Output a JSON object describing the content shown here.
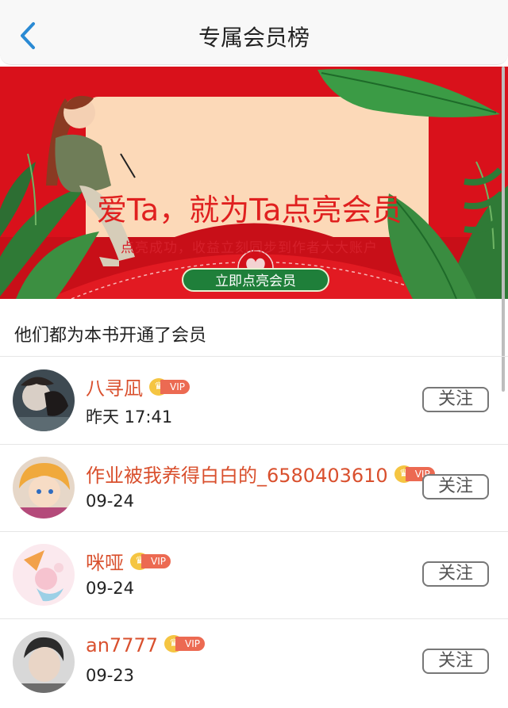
{
  "header": {
    "title": "专属会员榜",
    "back_icon": "chevron-left-icon",
    "accent": "#2a8ad4"
  },
  "banner": {
    "headline": "爱Ta，就为Ta点亮会员",
    "subtitle": "点亮成功，收益立刻同步到作者大大账户",
    "cta_label": "立即点亮会员",
    "colors": {
      "background": "#d9111b",
      "card": "#fcd9b8",
      "cta": "#1f7f3a"
    }
  },
  "section": {
    "title": "他们都为本书开通了会员"
  },
  "vip_badge_label": "VIP",
  "follow_label": "关注",
  "members": [
    {
      "name": "八寻凪",
      "date": "昨天 17:41"
    },
    {
      "name": "作业被我养得白白的_6580403610",
      "date": "09-24"
    },
    {
      "name": "咪哑",
      "date": "09-24"
    },
    {
      "name": "an7777",
      "date": "09-23"
    }
  ]
}
